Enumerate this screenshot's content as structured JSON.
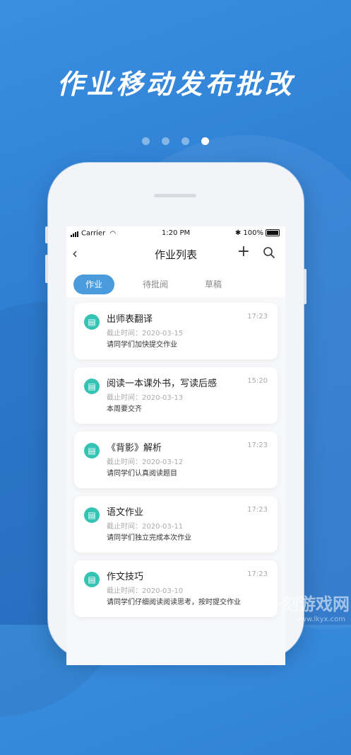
{
  "headline": "作业移动发布批改",
  "pager": {
    "count": 4,
    "active_index": 3
  },
  "status_bar": {
    "carrier": "Carrier",
    "time": "1:20 PM",
    "battery": "100%"
  },
  "nav": {
    "title": "作业列表",
    "back_icon": "chevron-left-icon",
    "add_icon": "plus-icon",
    "search_icon": "search-icon"
  },
  "tabs": [
    {
      "label": "作业",
      "active": true
    },
    {
      "label": "待批阅",
      "active": false
    },
    {
      "label": "草稿",
      "active": false
    }
  ],
  "items": [
    {
      "title": "出师表翻译",
      "time": "17:23",
      "deadline": "截止时间：2020-03-15",
      "desc": "请同学们加快提交作业"
    },
    {
      "title": "阅读一本课外书，写读后感",
      "time": "15:20",
      "deadline": "截止时间：2020-03-13",
      "desc": "本周要交齐"
    },
    {
      "title": "《背影》解析",
      "time": "17:23",
      "deadline": "截止时间：2020-03-12",
      "desc": "请同学们认真阅读题目"
    },
    {
      "title": "语文作业",
      "time": "17:23",
      "deadline": "截止时间：2020-03-11",
      "desc": "请同学们独立完成本次作业"
    },
    {
      "title": "作文技巧",
      "time": "17:23",
      "deadline": "截止时间：2020-03-10",
      "desc": "请同学们仔细阅读阅读思考，按时提交作业"
    }
  ],
  "watermark": {
    "text": "一刻游戏网",
    "url": "www.lkyx.com"
  },
  "colors": {
    "background": "#2f7fd4",
    "accent": "#4a9bdc",
    "icon_badge": "#35c4b4"
  }
}
